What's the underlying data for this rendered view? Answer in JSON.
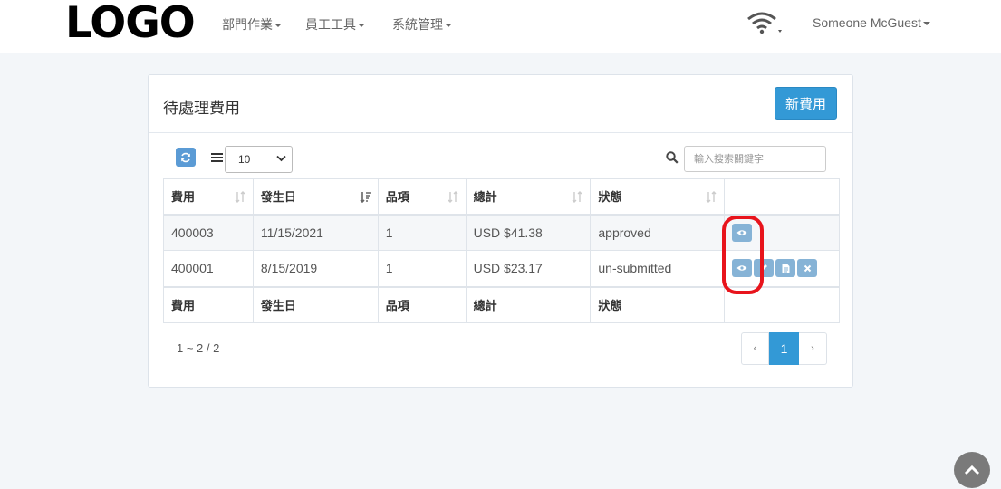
{
  "header": {
    "logo": "LOGO",
    "menus": [
      "部門作業",
      "員工工具",
      "系統管理"
    ],
    "user_name": "Someone McGuest"
  },
  "card": {
    "title": "待處理費用",
    "new_button": "新費用"
  },
  "toolbar": {
    "page_size": "10",
    "search_placeholder": "輸入搜索關鍵字"
  },
  "table": {
    "columns": [
      "費用",
      "發生日",
      "品項",
      "總計",
      "狀態"
    ],
    "rows": [
      {
        "id": "400003",
        "date": "11/15/2021",
        "items": "1",
        "total": "USD $41.38",
        "status": "approved"
      },
      {
        "id": "400001",
        "date": "8/15/2019",
        "items": "1",
        "total": "USD $23.17",
        "status": "un-submitted"
      }
    ],
    "footer": [
      "費用",
      "發生日",
      "品項",
      "總計",
      "狀態"
    ]
  },
  "pagination": {
    "range": "1 ~ 2 / 2",
    "prev": "‹",
    "current": "1",
    "next": "›"
  },
  "colors": {
    "accent": "#3399d6",
    "highlight": "#e8141c"
  }
}
